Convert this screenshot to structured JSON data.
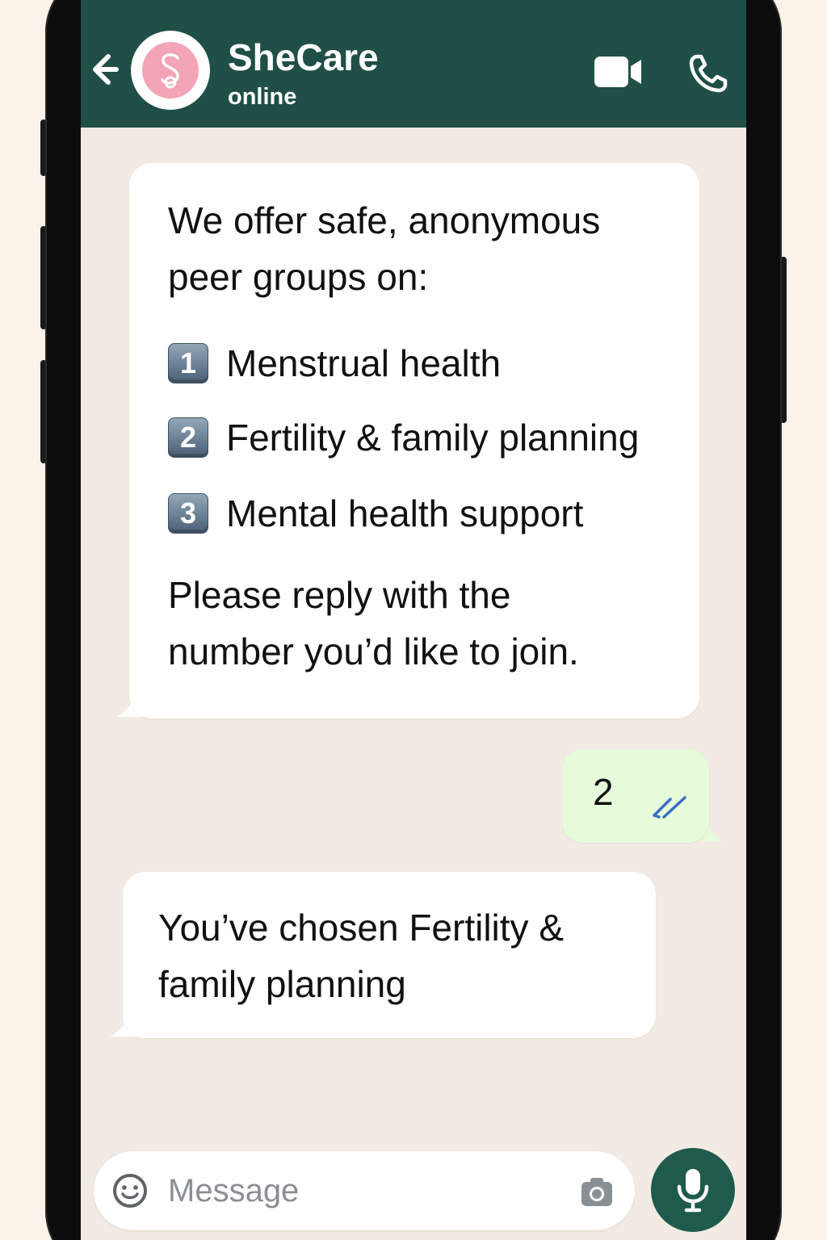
{
  "header": {
    "title": "SheCare",
    "status": "online",
    "avatar_letter": "S",
    "icons": {
      "back": "arrow-back-icon",
      "video": "video-camera-icon",
      "call": "phone-icon"
    }
  },
  "messages": {
    "m1": {
      "intro_line1": "We offer safe, anonymous",
      "intro_line2": "peer groups on:",
      "options": [
        {
          "number": "1",
          "label": "Menstrual health"
        },
        {
          "number": "2",
          "label": "Fertility & family planning"
        },
        {
          "number": "3",
          "label": "Mental health support"
        }
      ],
      "prompt_line1": "Please reply with the",
      "prompt_line2": "number you’d like to join."
    },
    "m2": {
      "text": "2",
      "status_icon": "double-check-icon"
    },
    "m3": {
      "line1": "You’ve chosen Fertility &",
      "line2": "family planning"
    }
  },
  "composer": {
    "placeholder": "Message",
    "icons": {
      "emoji": "emoji-icon",
      "camera": "camera-icon",
      "mic": "microphone-icon"
    }
  },
  "colors": {
    "header": "#1f4f46",
    "chat_background": "#f2ebe3",
    "incoming_bubble": "#ffffff",
    "outgoing_bubble": "#e6fbd9",
    "mic_button": "#1f5b4d",
    "avatar_accent": "#f3a4b7",
    "read_ticks": "#3b6fc2"
  }
}
